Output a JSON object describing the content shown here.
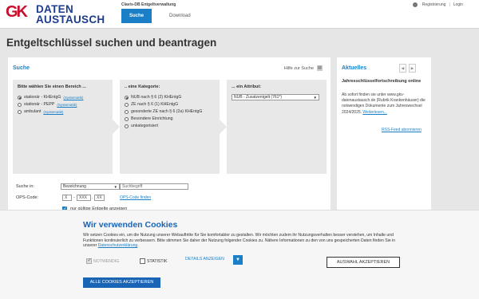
{
  "brand": {
    "logo_mark": "GK",
    "logo_line1": "DATEN",
    "logo_line2": "AUSTAUSCH",
    "system_name": "Clavis-DB Entgeltverwaltung"
  },
  "nav": {
    "search": "Suche",
    "download": "Download"
  },
  "header_links": {
    "register": "Registrierung",
    "separator": "|",
    "login": "Login"
  },
  "page_title": "Entgeltschlüssel suchen und beantragen",
  "search_panel": {
    "title": "Suche",
    "help": "Hilfe zur Suche",
    "col1": {
      "heading": "Bitte wählen Sie einen Bereich ...",
      "options": [
        {
          "label": "stationär - KHEntgG",
          "link": "(Systematik)",
          "selected": true
        },
        {
          "label": "stationär - PEPP",
          "link": "(Systematik)",
          "selected": false
        },
        {
          "label": "ambulant",
          "link": "(Systematik)",
          "selected": false
        }
      ]
    },
    "col2": {
      "heading": ".. eine Kategorie:",
      "options": [
        {
          "label": "NUB nach § 6 (2) KHEntgG",
          "selected": true
        },
        {
          "label": "ZE nach § 6 (1) KHEntgG",
          "selected": false
        },
        {
          "label": "gesonderte ZE nach § 6 (2a) KHEntgG",
          "selected": false
        },
        {
          "label": "Besondere Einrichtung",
          "selected": false
        },
        {
          "label": "unkategorisiert",
          "selected": false
        }
      ]
    },
    "col3": {
      "heading": "... ein Attribut:",
      "selected": "NUB - Zusatzentgelt (761*)"
    },
    "search_in_label": "Suche in:",
    "search_in_value": "Bezeichnung",
    "search_term_placeholder": "Suchbegriff",
    "ops_label": "OPS-Code:",
    "ops_parts": [
      "X",
      "XXX",
      "XX"
    ],
    "ops_dash": "-",
    "ops_dot": ".",
    "ops_find": "OPS-Code finden",
    "valid_only_label": "nur gültige Entgelte anzeigen"
  },
  "news": {
    "title": "Aktuelles",
    "prev": "◀",
    "next": "▶",
    "headline": "Jahresschlüsselfortschreibung online",
    "body": "Ab sofort finden sie unter www.gkv-datenaustausch.de (Rubrik Krankenhäuser) die notwendigen Dokumente zum Jahreswechsel 2024/2025.",
    "more": "Weiterlesen...",
    "rss": "RSS-Feed abonnieren"
  },
  "cookie": {
    "title": "Wir verwenden Cookies",
    "text_1": "Wir setzen Cookies ein, um die Nutzung unserer Webauftritte für Sie komfortabler zu gestalten. Wir möchten zudem ihr Nutzungsverhalten besser verstehen, um Inhalte und Funktionen kontinuierlich zu verbessern. Bitte stimmen Sie daher der Nutzung folgender Cookies zu. Nähere Informationen zu den von uns gespeicherten Daten finden Sie in unserer ",
    "privacy_link": "Datenschutzerklärung",
    "text_2": ".",
    "necessary": "NOTWENDIG",
    "statistics": "STATISTIK",
    "details": "DETAILS ANZEIGEN",
    "accept_selection": "AUSWAHL AKZEPTIEREN",
    "accept_all": "ALLE COOKIES AKZEPTIEREN"
  }
}
